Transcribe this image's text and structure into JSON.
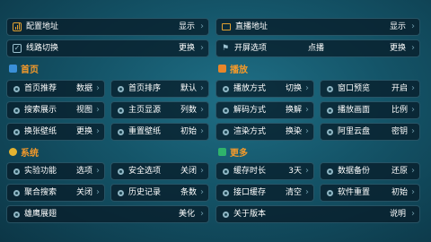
{
  "top": {
    "config": {
      "label": "配置地址",
      "value": "显示"
    },
    "live": {
      "label": "直播地址",
      "value": "显示"
    },
    "route": {
      "label": "线路切换",
      "value": "更换"
    },
    "splash": {
      "label": "开屏选项",
      "mid": "点播",
      "value": "更换"
    }
  },
  "sections": {
    "home": "首页",
    "play": "播放",
    "system": "系统",
    "more": "更多"
  },
  "home_items": [
    {
      "label": "首页推荐",
      "value": "数据"
    },
    {
      "label": "首页排序",
      "value": "默认"
    },
    {
      "label": "搜索展示",
      "value": "视图"
    },
    {
      "label": "主页显源",
      "value": "列数"
    },
    {
      "label": "换张壁纸",
      "value": "更换"
    },
    {
      "label": "重置壁纸",
      "value": "初始"
    }
  ],
  "play_items": [
    {
      "label": "播放方式",
      "value": "切换"
    },
    {
      "label": "窗口预览",
      "value": "开启"
    },
    {
      "label": "解码方式",
      "value": "换解"
    },
    {
      "label": "播放画面",
      "value": "比例"
    },
    {
      "label": "渲染方式",
      "value": "换染"
    },
    {
      "label": "阿里云盘",
      "value": "密钥"
    }
  ],
  "system_items": [
    {
      "label": "实验功能",
      "value": "选项"
    },
    {
      "label": "安全选项",
      "value": "关闭"
    },
    {
      "label": "聚合搜索",
      "value": "关闭"
    },
    {
      "label": "历史记录",
      "value": "条数"
    },
    {
      "label": "雄鹰展翅",
      "value": "美化"
    }
  ],
  "more_items": [
    {
      "label": "缓存时长",
      "value": "3天"
    },
    {
      "label": "数据备份",
      "value": "还原"
    },
    {
      "label": "接口缓存",
      "value": "清空"
    },
    {
      "label": "软件重置",
      "value": "初始"
    },
    {
      "label": "关于版本",
      "value": "说明"
    }
  ],
  "icons": {
    "chevron": "chevron-right-icon",
    "bullet": "settings-dot-icon"
  },
  "colors": {
    "section_header": "#f59a2a",
    "tile_bg": "#081e2a",
    "background": "#145468"
  }
}
